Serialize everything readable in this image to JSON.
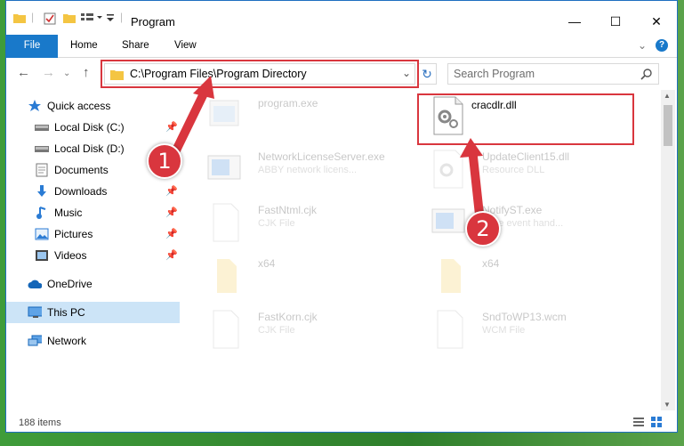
{
  "window": {
    "title": "Program",
    "minimize_glyph": "—",
    "maximize_glyph": "☐",
    "close_glyph": "✕"
  },
  "ribbon": {
    "tabs": [
      {
        "label": "File"
      },
      {
        "label": "Home"
      },
      {
        "label": "Share"
      },
      {
        "label": "View"
      }
    ],
    "help_glyph": "?"
  },
  "address": {
    "path": "C:\\Program Files\\Program Directory",
    "search_placeholder": "Search Program"
  },
  "nav_pane": {
    "items": [
      {
        "label": "Quick access",
        "icon": "star-icon",
        "pinned": false
      },
      {
        "label": "Local Disk (C:)",
        "icon": "drive-icon",
        "pinned": true
      },
      {
        "label": "Local Disk (D:)",
        "icon": "drive-icon",
        "pinned": false
      },
      {
        "label": "Documents",
        "icon": "documents-icon",
        "pinned": true
      },
      {
        "label": "Downloads",
        "icon": "download-icon",
        "pinned": true
      },
      {
        "label": "Music",
        "icon": "music-icon",
        "pinned": true
      },
      {
        "label": "Pictures",
        "icon": "pictures-icon",
        "pinned": true
      },
      {
        "label": "Videos",
        "icon": "videos-icon",
        "pinned": true
      },
      {
        "label": "OneDrive",
        "icon": "cloud-icon",
        "pinned": false
      },
      {
        "label": "This PC",
        "icon": "computer-icon",
        "pinned": false,
        "selected": true
      },
      {
        "label": "Network",
        "icon": "network-icon",
        "pinned": false
      }
    ]
  },
  "files": [
    {
      "name": "program.exe",
      "type": "",
      "icon": "exe-icon"
    },
    {
      "name": "cracdlr.dll",
      "type": "",
      "icon": "dll-icon",
      "highlighted": true
    },
    {
      "name": "NetworkLicenseServer.exe",
      "type": "ABBY network licens...",
      "icon": "exe-icon"
    },
    {
      "name": "UpdateClient15.dll",
      "type": "Resource DLL",
      "icon": "dll-icon"
    },
    {
      "name": "FastNtml.cjk",
      "type": "CJK File",
      "icon": "file-icon"
    },
    {
      "name": "NotifyST.exe",
      "type": "...ate event hand...",
      "icon": "exe-icon"
    },
    {
      "name": "x64",
      "type": "",
      "icon": "folder-icon"
    },
    {
      "name": "x64",
      "type": "",
      "icon": "folder-icon"
    },
    {
      "name": "FastKorn.cjk",
      "type": "CJK File",
      "icon": "file-icon"
    },
    {
      "name": "SndToWP13.wcm",
      "type": "WCM File",
      "icon": "file-icon"
    }
  ],
  "status": {
    "item_count": "188 items"
  },
  "callouts": [
    {
      "number": "1"
    },
    {
      "number": "2"
    }
  ],
  "colors": {
    "accent": "#1979ca",
    "highlight": "#d9363e",
    "selected": "#cce4f7"
  }
}
